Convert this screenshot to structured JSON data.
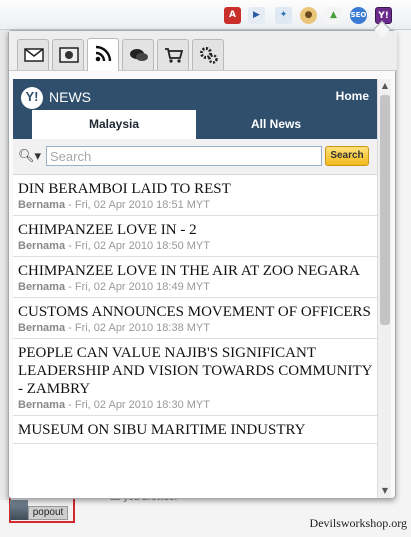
{
  "toolbar": {
    "icons": [
      "adobe-icon",
      "play-icon",
      "tweet-icon",
      "cookie-icon",
      "chrome-icon",
      "seo-icon",
      "yahoo-icon"
    ]
  },
  "popup": {
    "tabs": [
      "mail-tab",
      "image-tab",
      "rss-tab",
      "chat-tab",
      "cart-tab",
      "settings-tab"
    ],
    "active_tab": "rss-tab",
    "header": {
      "title": "NEWS",
      "logo": "Y!",
      "home_label": "Home"
    },
    "tabs_news": {
      "selected": "Malaysia",
      "other": "All News"
    },
    "search": {
      "placeholder": "Search",
      "button": "Search"
    },
    "news": [
      {
        "headline": "DIN BERAMBOI LAID TO REST",
        "source": "Bernama",
        "date": " - Fri, 02 Apr 2010 18:51 MYT"
      },
      {
        "headline": "CHIMPANZEE LOVE IN - 2",
        "source": "Bernama",
        "date": " - Fri, 02 Apr 2010 18:50 MYT"
      },
      {
        "headline": "CHIMPANZEE LOVE IN THE AIR AT ZOO NEGARA",
        "source": "Bernama",
        "date": " - Fri, 02 Apr 2010 18:49 MYT"
      },
      {
        "headline": "CUSTOMS ANNOUNCES MOVEMENT OF OFFICERS",
        "source": "Bernama",
        "date": " - Fri, 02 Apr 2010 18:38 MYT"
      },
      {
        "headline": "PEOPLE CAN VALUE NAJIB'S SIGNIFICANT LEADERSHIP AND VISION TOWARDS COMMUNITY - ZAMBRY",
        "source": "Bernama",
        "date": " - Fri, 02 Apr 2010 18:30 MYT"
      },
      {
        "headline": "MUSEUM ON SIBU MARITIME INDUSTRY",
        "source": "",
        "date": ""
      }
    ]
  },
  "page": {
    "background_text": "as you browse.",
    "popout_label": "popout",
    "watermark": "Devilsworkshop.org"
  }
}
